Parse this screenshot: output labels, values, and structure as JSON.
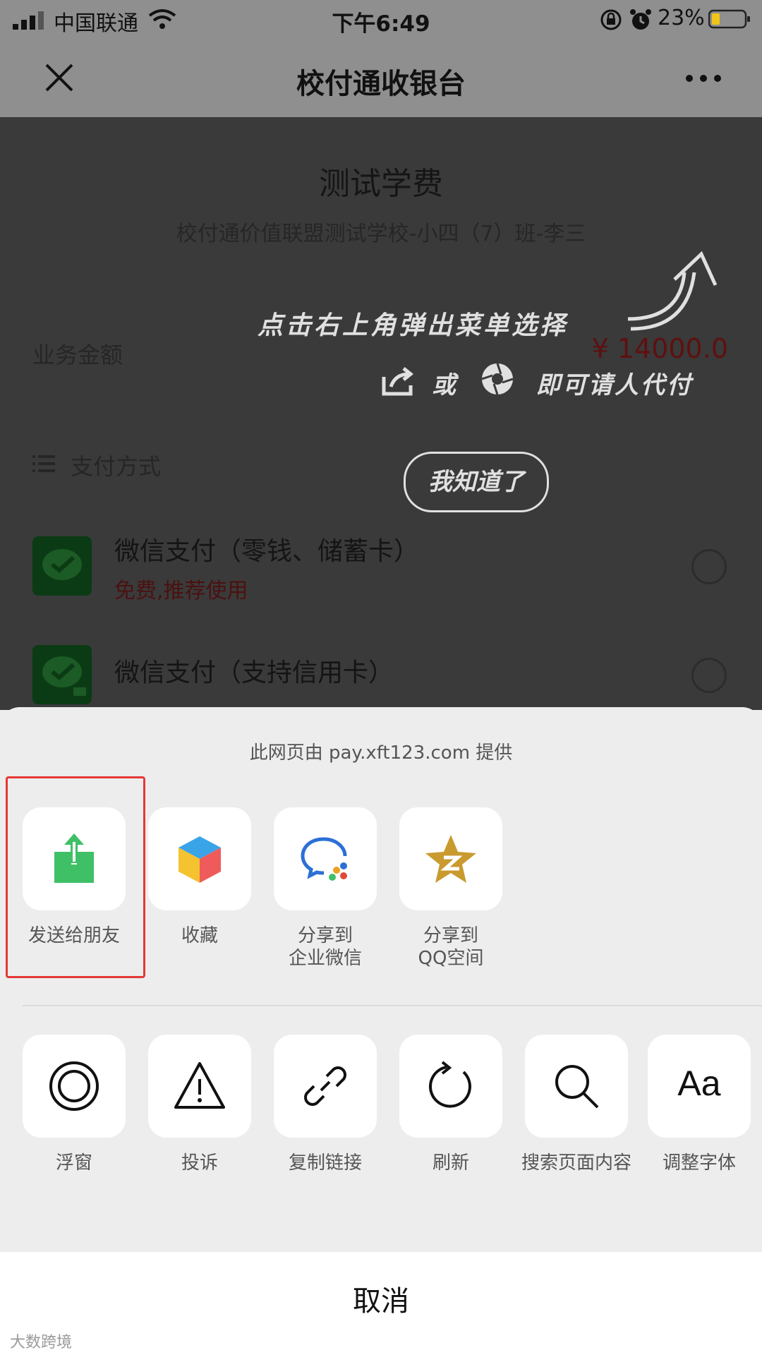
{
  "status_bar": {
    "carrier": "中国联通",
    "time": "下午6:49",
    "battery": "23%"
  },
  "nav": {
    "title": "校付通收银台"
  },
  "page": {
    "item_title": "测试学费",
    "item_subtitle": "校付通价值联盟测试学校-小四（7）班-李三",
    "amount_label": "业务金额",
    "amount_value": "¥ 14000.0",
    "payment_method_label": "支付方式",
    "payment_options": [
      {
        "name": "微信支付（零钱、储蓄卡）",
        "note": "免费,推荐使用"
      },
      {
        "name": "微信支付（支持信用卡）"
      }
    ]
  },
  "guide_overlay": {
    "line1": "点击右上角弹出菜单选择",
    "or": "或",
    "line2_suffix": "即可请人代付",
    "dismiss_button": "我知道了"
  },
  "sheet": {
    "provider": "此网页由 pay.xft123.com 提供",
    "share_actions": [
      {
        "label": "发送给朋友",
        "icon": "send-to-friend-icon",
        "color": "#3fc067"
      },
      {
        "label": "收藏",
        "icon": "favorite-cube-icon"
      },
      {
        "label": "分享到\n企业微信",
        "icon": "wecom-icon"
      },
      {
        "label": "分享到\nQQ空间",
        "icon": "qzone-star-icon",
        "color": "#c99a2e"
      }
    ],
    "tool_actions": [
      {
        "label": "浮窗",
        "icon": "float-window-icon"
      },
      {
        "label": "投诉",
        "icon": "warning-icon"
      },
      {
        "label": "复制链接",
        "icon": "link-icon"
      },
      {
        "label": "刷新",
        "icon": "refresh-icon"
      },
      {
        "label": "搜索页面内容",
        "icon": "search-icon"
      },
      {
        "label": "调整字体",
        "icon": "font-size-icon",
        "glyph": "Aa"
      }
    ],
    "cancel": "取消"
  },
  "watermark": "大数跨境",
  "colors": {
    "highlight_border": "#e53935",
    "amount": "#5e1010",
    "sheet_bg": "#ededed"
  }
}
